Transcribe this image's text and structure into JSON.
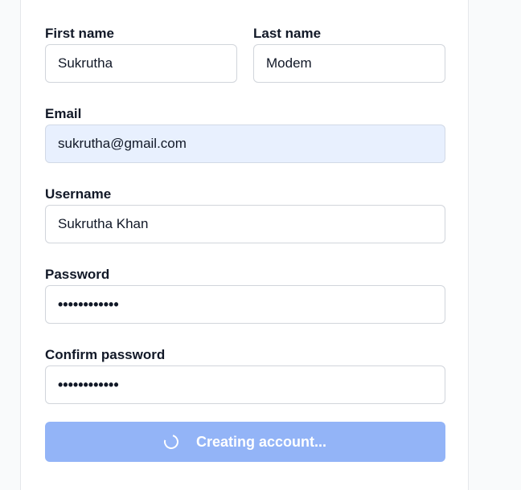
{
  "form": {
    "first_name": {
      "label": "First name",
      "value": "Sukrutha"
    },
    "last_name": {
      "label": "Last name",
      "value": "Modem"
    },
    "email": {
      "label": "Email",
      "value": "sukrutha@gmail.com"
    },
    "username": {
      "label": "Username",
      "value": "Sukrutha Khan"
    },
    "password": {
      "label": "Password",
      "value": "••••••••••••"
    },
    "confirm_password": {
      "label": "Confirm password",
      "value": "••••••••••••"
    },
    "submit": {
      "label": "Creating account...",
      "icon": "spinner-icon",
      "state": "loading"
    }
  },
  "colors": {
    "button_bg": "#93b4f7",
    "autofill_bg": "#e8f0fe"
  }
}
